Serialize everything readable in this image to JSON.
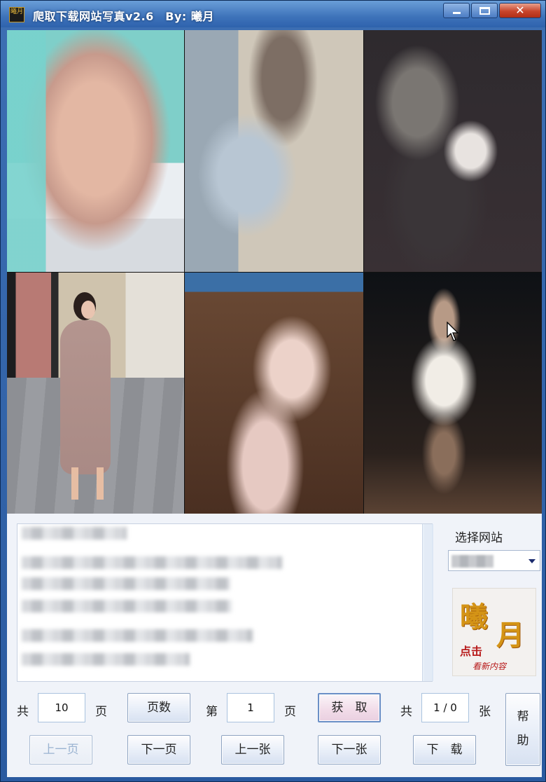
{
  "window": {
    "title": "爬取下载网站写真v2.6　By: 曦月",
    "icon_text": "曦月",
    "controls": {
      "minimize": "minimize-icon",
      "maximize": "maximize-icon",
      "close": "✕"
    }
  },
  "gallery": {
    "photos": [
      {
        "icon": "photo-thumbnail"
      },
      {
        "icon": "photo-thumbnail"
      },
      {
        "icon": "photo-thumbnail"
      },
      {
        "icon": "photo-thumbnail"
      },
      {
        "icon": "photo-thumbnail"
      },
      {
        "icon": "photo-thumbnail"
      }
    ]
  },
  "site_panel": {
    "label": "选择网站",
    "logo": {
      "big1": "曦",
      "big2": "月",
      "red": "点击",
      "small": "看新内容"
    }
  },
  "controls": {
    "total_prefix": "共",
    "total_pages": "10",
    "page_unit": "页",
    "pages_button": "页数",
    "current_prefix": "第",
    "current_page": "1",
    "current_unit": "页",
    "fetch_button": "获　取",
    "images_prefix": "共",
    "image_counter": "1 / 0",
    "images_unit": "张",
    "help_button_line1": "帮",
    "help_button_line2": "助",
    "prev_page": "上一页",
    "next_page": "下一页",
    "prev_image": "上一张",
    "next_image": "下一张",
    "download": "下　载"
  }
}
